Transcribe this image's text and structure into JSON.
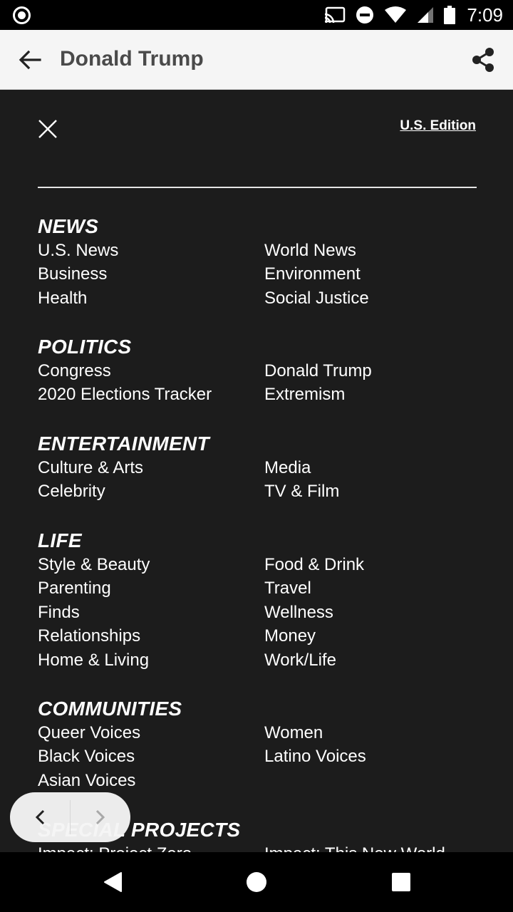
{
  "status_bar": {
    "time": "7:09"
  },
  "app_bar": {
    "title": "Donald Trump"
  },
  "menu": {
    "edition": "U.S. Edition",
    "sections": [
      {
        "title": "NEWS",
        "links": [
          "U.S. News",
          "World News",
          "Business",
          "Environment",
          "Health",
          "Social Justice"
        ]
      },
      {
        "title": "POLITICS",
        "links": [
          "Congress",
          "Donald Trump",
          "2020 Elections Tracker",
          "Extremism"
        ]
      },
      {
        "title": "ENTERTAINMENT",
        "links": [
          "Culture & Arts",
          "Media",
          "Celebrity",
          "TV & Film"
        ]
      },
      {
        "title": "LIFE",
        "links": [
          "Style & Beauty",
          "Food & Drink",
          "Parenting",
          "Travel",
          "Finds",
          "Wellness",
          "Relationships",
          "Money",
          "Home & Living",
          "Work/Life"
        ]
      },
      {
        "title": "COMMUNITIES",
        "links": [
          "Queer Voices",
          "Women",
          "Black Voices",
          "Latino Voices",
          "Asian Voices"
        ]
      },
      {
        "title": "SPECIAL PROJECTS",
        "links": [
          "Impact: Project Zero",
          "Impact: This New World"
        ]
      }
    ]
  },
  "icons": {
    "status": [
      "record-icon",
      "cast-icon",
      "do-not-disturb-icon",
      "wifi-icon",
      "signal-icon",
      "battery-icon"
    ],
    "app_bar": [
      "back-arrow-icon",
      "share-icon"
    ],
    "menu": [
      "close-icon"
    ],
    "nav_pill": [
      "chevron-left-icon",
      "chevron-right-icon"
    ],
    "system_nav": [
      "back-triangle-icon",
      "home-circle-icon",
      "recents-square-icon"
    ]
  },
  "colors": {
    "app_bar_bg": "#f5f5f5",
    "menu_bg": "#1c1c1c",
    "text": "#ffffff",
    "title_text": "#4a4a4a"
  }
}
